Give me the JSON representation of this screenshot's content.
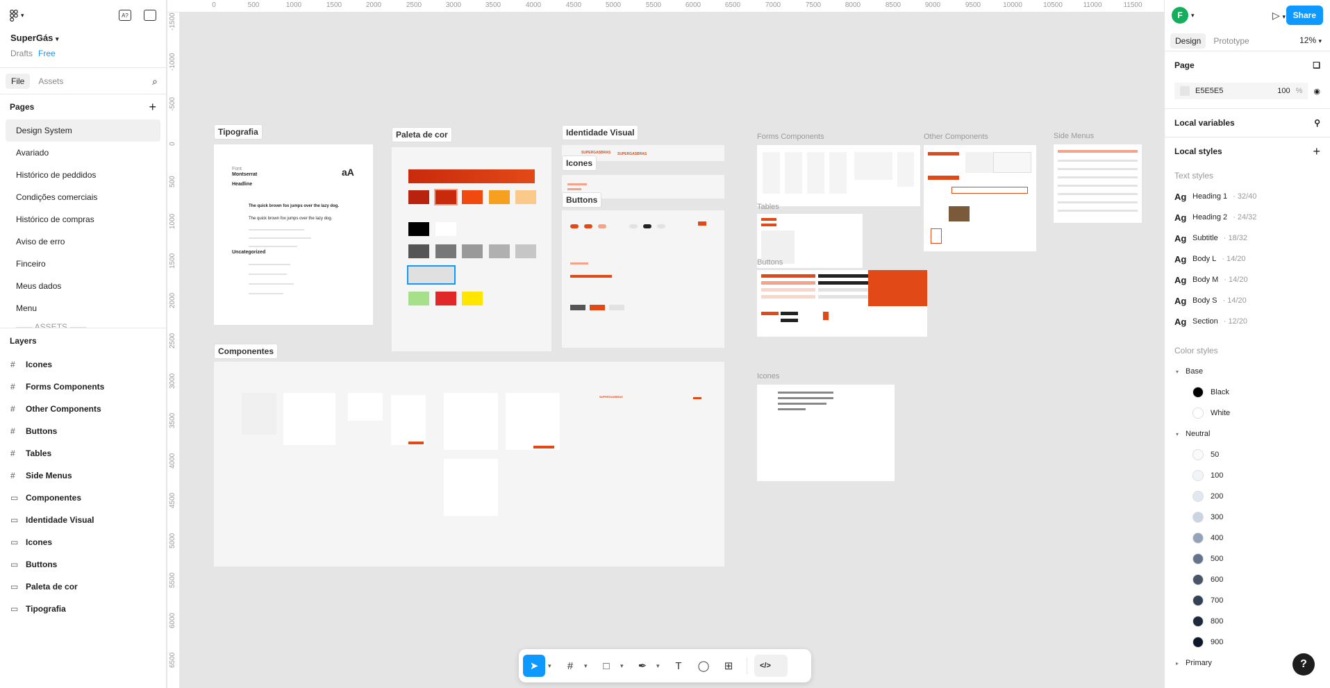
{
  "file": {
    "name": "SuperGás",
    "location": "Drafts",
    "plan": "Free"
  },
  "left_tabs": {
    "file": "File",
    "assets": "Assets"
  },
  "pages": {
    "title": "Pages",
    "items": [
      "Design System",
      "Avariado",
      "Histórico de peddidos",
      "Condições comerciais",
      "Histórico de compras",
      "Aviso de erro",
      "Finceiro",
      "Meus dados",
      "Menu",
      "—— ASSETS ——"
    ]
  },
  "layers": {
    "title": "Layers",
    "items": [
      {
        "label": "Icones",
        "kind": "frame"
      },
      {
        "label": "Forms Components",
        "kind": "frame"
      },
      {
        "label": "Other Components",
        "kind": "frame"
      },
      {
        "label": "Buttons",
        "kind": "frame"
      },
      {
        "label": "Tables",
        "kind": "frame"
      },
      {
        "label": "Side Menus",
        "kind": "frame"
      },
      {
        "label": "Componentes",
        "kind": "section"
      },
      {
        "label": "Identidade Visual",
        "kind": "section"
      },
      {
        "label": "Icones",
        "kind": "section"
      },
      {
        "label": "Buttons",
        "kind": "section"
      },
      {
        "label": "Paleta de cor",
        "kind": "section"
      },
      {
        "label": "Tipografia",
        "kind": "section"
      }
    ]
  },
  "ruler_top": [
    "0",
    "500",
    "1000",
    "1500",
    "2000",
    "2500",
    "3000",
    "3500",
    "4000",
    "4500",
    "5000",
    "5500",
    "6000",
    "6500",
    "7000",
    "7500",
    "8000",
    "8500",
    "9000",
    "9500",
    "10000",
    "10500",
    "11000",
    "11500"
  ],
  "ruler_left": [
    "-1500",
    "-1000",
    "-500",
    "0",
    "500",
    "1000",
    "1500",
    "2000",
    "2500",
    "3000",
    "3500",
    "4000",
    "4500",
    "5000",
    "5500",
    "6000",
    "6500"
  ],
  "canvas": {
    "sections": {
      "tipografia": "Tipografia",
      "paleta": "Paleta de cor",
      "identidade": "Identidade Visual",
      "icones": "Icones",
      "buttons": "Buttons",
      "componentes": "Componentes"
    },
    "frames": {
      "forms": "Forms Components",
      "other": "Other Components",
      "side": "Side Menus",
      "tables": "Tables",
      "buttons": "Buttons",
      "icones": "Icones"
    },
    "tipografia_card": {
      "font_label": "Font",
      "font_name": "Montserrat",
      "aa": "aA",
      "headline": "Headline",
      "sample1": "The quick brown fox jumps over the lazy dog.",
      "sample2": "The quick brown fox jumps over the lazy dog.",
      "uncategorized": "Uncategorized"
    },
    "brand": "SUPERGASBRAS"
  },
  "toolbar": {
    "dev_label": "</>"
  },
  "right": {
    "user_initial": "F",
    "share": "Share",
    "tabs": {
      "design": "Design",
      "prototype": "Prototype"
    },
    "zoom": "12%",
    "page_title": "Page",
    "page_fill": "E5E5E5",
    "page_opacity": "100",
    "page_opacity_unit": "%",
    "local_variables": "Local variables",
    "local_styles": "Local styles",
    "text_styles_title": "Text styles",
    "text_styles": [
      {
        "name": "Heading 1",
        "spec": "32/40"
      },
      {
        "name": "Heading 2",
        "spec": "24/32"
      },
      {
        "name": "Subtitle",
        "spec": "18/32"
      },
      {
        "name": "Body L",
        "spec": "14/20"
      },
      {
        "name": "Body M",
        "spec": "14/20"
      },
      {
        "name": "Body S",
        "spec": "14/20"
      },
      {
        "name": "Section",
        "spec": "12/20"
      }
    ],
    "color_styles_title": "Color styles",
    "color_groups": {
      "base": "Base",
      "neutral": "Neutral",
      "primary": "Primary"
    },
    "base_colors": [
      {
        "name": "Black",
        "hex": "#000000"
      },
      {
        "name": "White",
        "hex": "#ffffff"
      }
    ],
    "neutral_colors": [
      {
        "name": "50",
        "hex": "#f8fafc"
      },
      {
        "name": "100",
        "hex": "#f1f5f9"
      },
      {
        "name": "200",
        "hex": "#e2e8f0"
      },
      {
        "name": "300",
        "hex": "#cbd5e1"
      },
      {
        "name": "400",
        "hex": "#94a3b8"
      },
      {
        "name": "500",
        "hex": "#64748b"
      },
      {
        "name": "600",
        "hex": "#475569"
      },
      {
        "name": "700",
        "hex": "#334155"
      },
      {
        "name": "800",
        "hex": "#1e293b"
      },
      {
        "name": "900",
        "hex": "#0f172a"
      }
    ],
    "help": "?"
  },
  "colors": {
    "accent": "#0d99ff",
    "brand_orange": "#e14a17",
    "canvas_bg": "#e5e5e5"
  }
}
